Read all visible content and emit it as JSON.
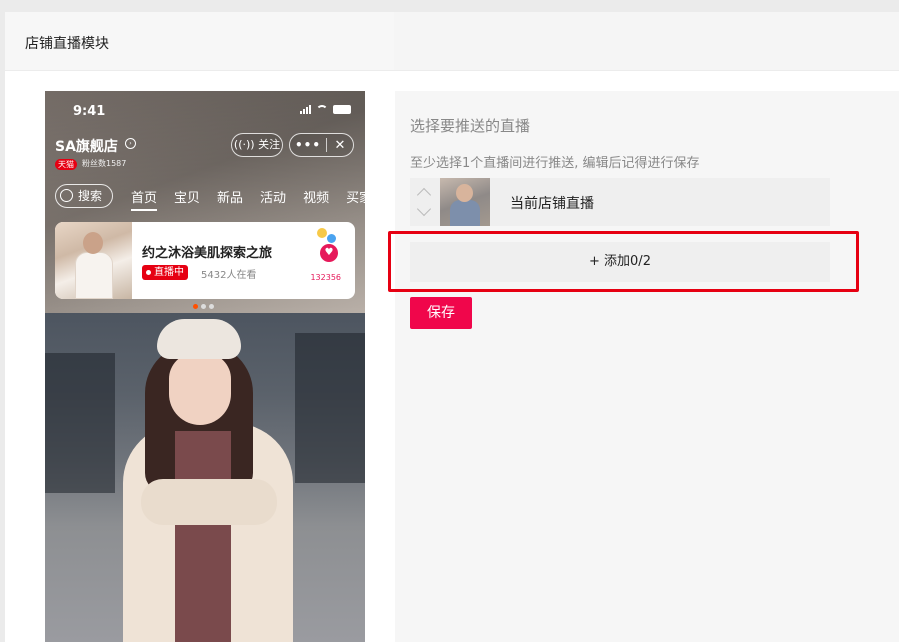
{
  "header": {
    "title": "店铺直播模块"
  },
  "phone": {
    "status_time": "9:41",
    "shop_name": "SA旗舰店",
    "tmall_badge": "天猫",
    "fans": "粉丝数1587",
    "follow_label": "关注",
    "more_label": "•••",
    "close_label": "✕",
    "search_label": "搜索",
    "tabs": [
      "首页",
      "宝贝",
      "新品",
      "活动",
      "视频",
      "买家"
    ],
    "active_tab": "首页",
    "live_card": {
      "title": "约之沐浴美肌探索之旅",
      "tag": "直播中",
      "viewers": "5432人在看",
      "likes": "132356"
    }
  },
  "panel": {
    "title": "选择要推送的直播",
    "hint": "至少选择1个直播间进行推送, 编辑后记得进行保存",
    "row_label": "当前店铺直播",
    "add_label": "+ 添加0/2",
    "save_label": "保存"
  },
  "colors": {
    "accent": "#f0064b",
    "highlight": "#e60012",
    "tmall": "#e60012"
  }
}
